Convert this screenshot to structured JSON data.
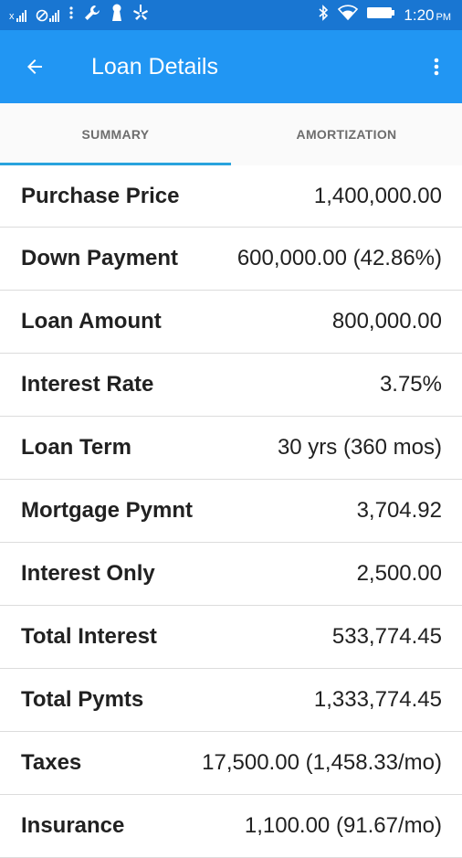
{
  "status_bar": {
    "time": "1:20",
    "ampm": "PM",
    "icons": [
      "signal-x-icon",
      "no-signal-icon",
      "more-vert-icon",
      "wrench-icon",
      "keyhole-icon",
      "yelp-icon",
      "bluetooth-icon",
      "wifi-icon",
      "battery-icon"
    ]
  },
  "app_bar": {
    "title": "Loan Details",
    "back_icon": "arrow-back-icon",
    "menu_icon": "overflow-menu-icon"
  },
  "tabs": [
    {
      "label": "SUMMARY",
      "active": true
    },
    {
      "label": "AMORTIZATION",
      "active": false
    }
  ],
  "accent_color": "#29a3dd",
  "rows": [
    {
      "label": "Purchase Price",
      "value": "1,400,000.00"
    },
    {
      "label": "Down Payment",
      "value": "600,000.00 (42.86%)"
    },
    {
      "label": "Loan Amount",
      "value": "800,000.00"
    },
    {
      "label": "Interest Rate",
      "value": "3.75%"
    },
    {
      "label": "Loan Term",
      "value": "30 yrs (360 mos)"
    },
    {
      "label": "Mortgage Pymnt",
      "value": "3,704.92"
    },
    {
      "label": "Interest Only",
      "value": "2,500.00"
    },
    {
      "label": "Total Interest",
      "value": "533,774.45"
    },
    {
      "label": "Total Pymts",
      "value": "1,333,774.45"
    },
    {
      "label": "Taxes",
      "value": "17,500.00 (1,458.33/mo)"
    },
    {
      "label": "Insurance",
      "value": "1,100.00 (91.67/mo)"
    }
  ]
}
